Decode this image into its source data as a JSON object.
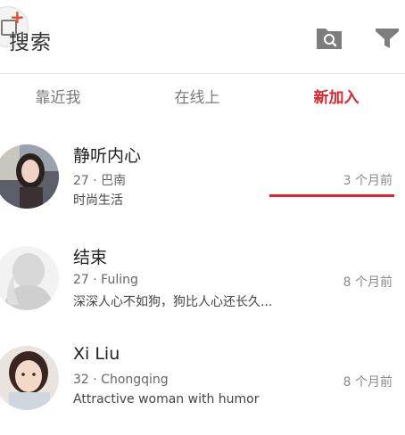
{
  "header": {
    "title": "搜索",
    "icons": {
      "logo": "add-app-icon",
      "folder": "folder-search-icon",
      "filter": "filter-icon"
    }
  },
  "tabs": [
    {
      "label": "靠近我",
      "active": false
    },
    {
      "label": "在线上",
      "active": false
    },
    {
      "label": "新加入",
      "active": true
    }
  ],
  "accent_color": "#d9262e",
  "users": [
    {
      "name": "静听内心",
      "meta": "27 · 巴南",
      "desc": "时尚生活",
      "time": "3 个月前"
    },
    {
      "name": "结束",
      "meta": "27 · Fuling",
      "desc": "深深人心不如狗，狗比人心还长久...",
      "time": "8 个月前"
    },
    {
      "name": "Xi Liu",
      "meta": "32 · Chongqing",
      "desc": "Attractive woman with humor",
      "time": "8 个月前"
    }
  ]
}
